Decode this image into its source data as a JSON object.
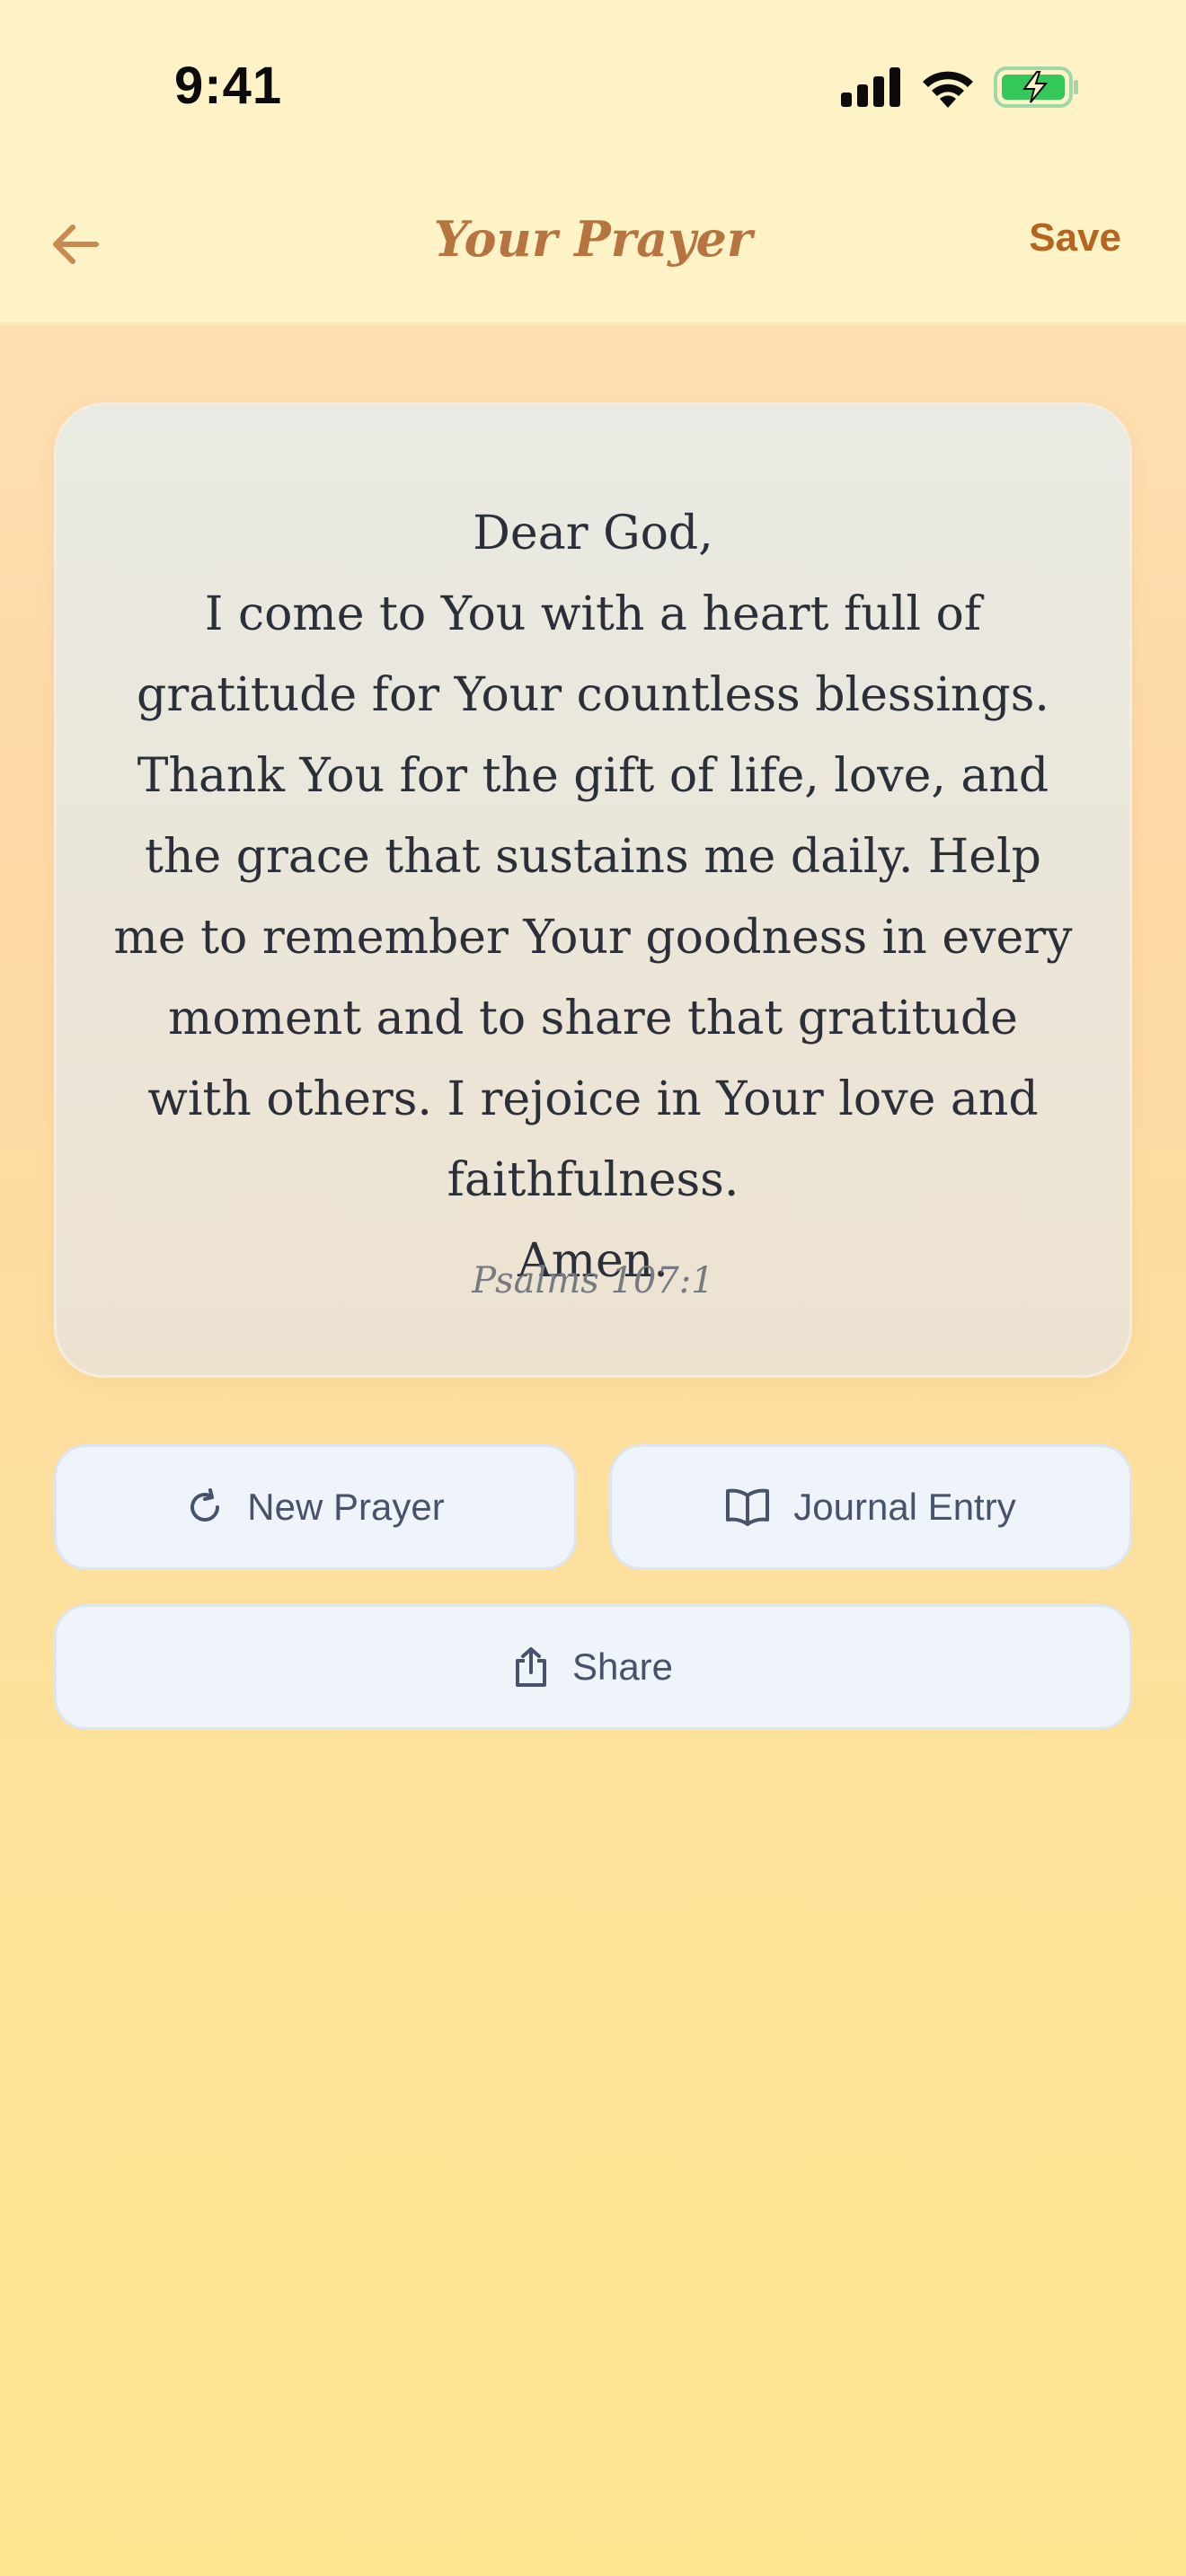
{
  "status_bar": {
    "time": "9:41",
    "icons": [
      "cellular-signal-icon",
      "wifi-icon",
      "battery-charging-icon"
    ]
  },
  "nav": {
    "back_icon": "arrow-left-icon",
    "title": "Your Prayer",
    "save_label": "Save"
  },
  "prayer": {
    "text": "Dear God,\nI come to You with a heart full of gratitude for Your countless blessings. Thank You for the gift of life, love, and the grace that sustains me daily. Help me to remember Your goodness in every moment and to share that gratitude with others. I rejoice in Your love and faithfulness.\nAmen.",
    "reference": "Psalms 107:1"
  },
  "actions": {
    "new_prayer": {
      "label": "New Prayer",
      "icon": "refresh-icon"
    },
    "journal_entry": {
      "label": "Journal Entry",
      "icon": "book-open-icon"
    },
    "share": {
      "label": "Share",
      "icon": "share-icon"
    }
  },
  "colors": {
    "accent": "#b4651e",
    "title": "#b8743e",
    "header_bg": "#fef3c7",
    "button_bg": "#eff3fa",
    "button_text": "#46536b",
    "battery_green": "#34c759"
  }
}
